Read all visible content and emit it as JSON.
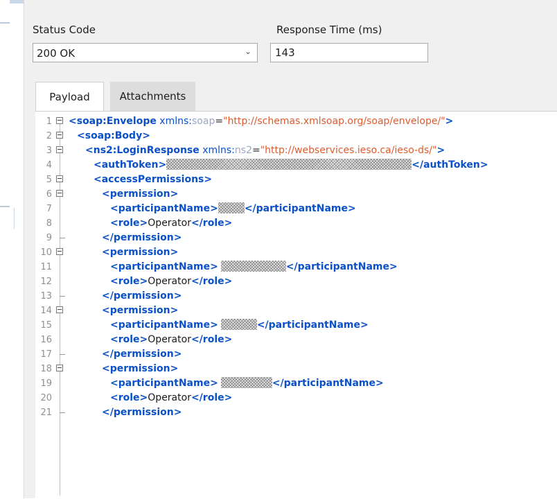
{
  "fields": {
    "status_code_label": "Status Code",
    "status_code_value": "200 OK",
    "response_time_label": "Response Time (ms)",
    "response_time_value": "143"
  },
  "tabs": [
    "Payload",
    "Attachments"
  ],
  "active_tab": "Payload",
  "editor": {
    "line_numbers": [
      "1",
      "2",
      "3",
      "4",
      "5",
      "6",
      "7",
      "8",
      "9",
      "10",
      "11",
      "12",
      "13",
      "14",
      "15",
      "16",
      "17",
      "18",
      "19",
      "20",
      "21"
    ],
    "xml": {
      "envelope_tag": "soap:Envelope",
      "envelope_attr_prefix": "xmlns:",
      "envelope_attr_name": "soap",
      "envelope_attr_value": "\"http://schemas.xmlsoap.org/soap/envelope/\"",
      "body_tag": "soap:Body",
      "login_tag": "ns2:LoginResponse",
      "login_attr_prefix": "xmlns:",
      "login_attr_name": "ns2",
      "login_attr_value": "\"http://webservices.ieso.ca/ieso-ds/\"",
      "auth_open": "<authToken>",
      "auth_close": "</authToken>",
      "access_open": "<accessPermissions>",
      "permission_open": "<permission>",
      "permission_close": "</permission>",
      "participant_open": "<participantName>",
      "participant_close": "</participantName>",
      "role_open": "<role>",
      "role_close": "</role>",
      "role_value": "Operator"
    }
  },
  "colors": {
    "tag": "#0a50c8",
    "attr_prefix": "#9aa6c4",
    "attr_value": "#e05a2b",
    "panel_bg": "#f0f0f0",
    "accent_rule": "#c9d7e8"
  }
}
